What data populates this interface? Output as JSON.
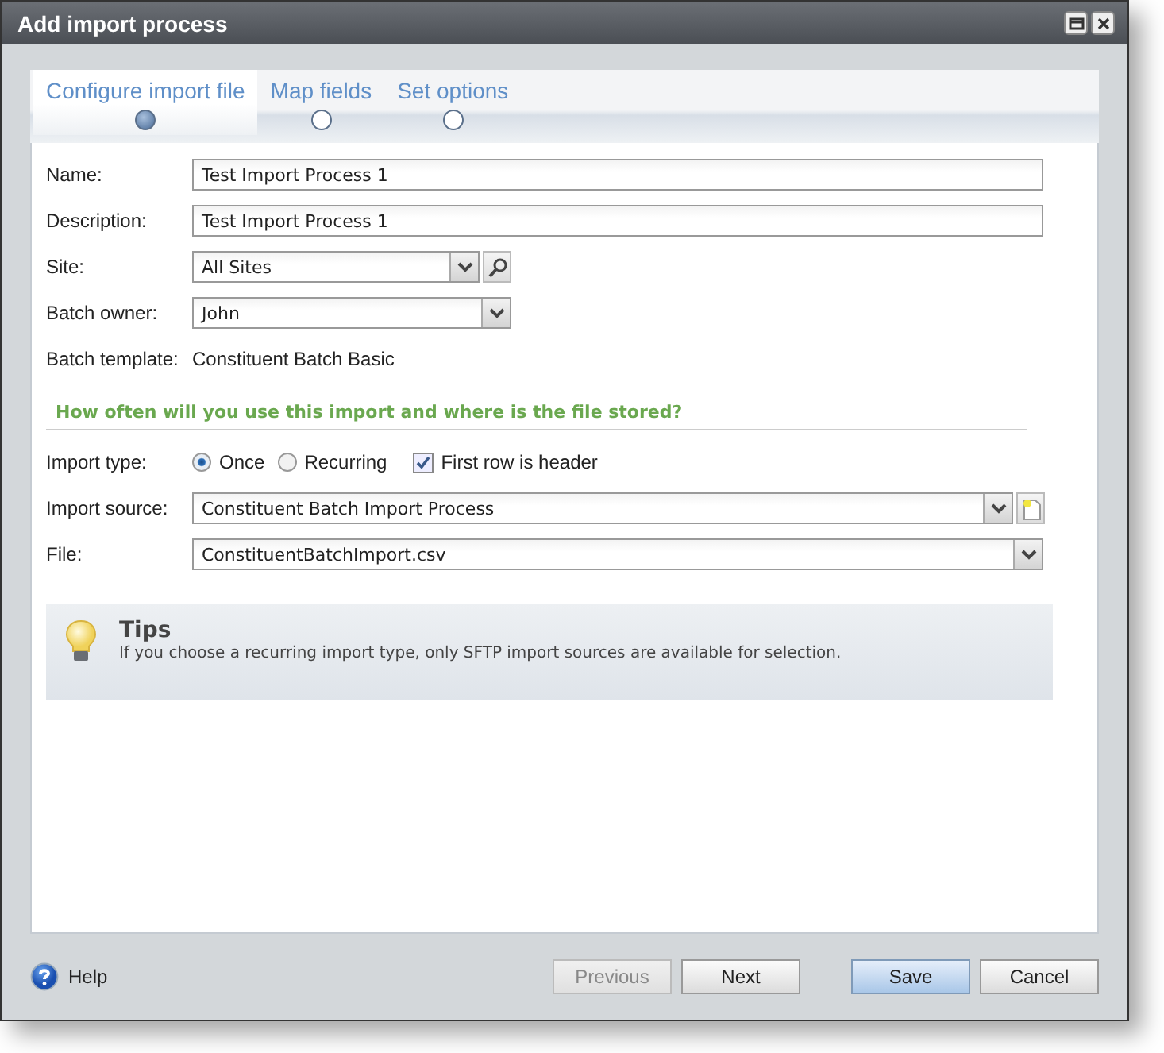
{
  "window": {
    "title": "Add import process"
  },
  "tabs": [
    {
      "label": "Configure import file",
      "selected": true
    },
    {
      "label": "Map fields",
      "selected": false
    },
    {
      "label": "Set options",
      "selected": false
    }
  ],
  "general_fields": [
    {
      "kind": "text",
      "label": "Name:",
      "value": "Test Import Process 1"
    },
    {
      "kind": "text",
      "label": "Description:",
      "value": "Test Import Process 1"
    },
    {
      "kind": "lookup",
      "label": "Site:",
      "value": "All Sites"
    },
    {
      "kind": "combo",
      "label": "Batch owner:",
      "value": "John"
    },
    {
      "kind": "static",
      "label": "Batch template:",
      "value": "Constituent Batch Basic"
    }
  ],
  "section": {
    "title": "How often will you use this import and where is the file stored?"
  },
  "import_type": {
    "label": "Import type:",
    "options": [
      {
        "label": "Once",
        "selected": true
      },
      {
        "label": "Recurring",
        "selected": false
      }
    ],
    "header_checkbox": {
      "label": "First row is header",
      "checked": true
    }
  },
  "source_fields": [
    {
      "kind": "combo_add",
      "label": "Import source:",
      "value": "Constituent Batch Import Process"
    },
    {
      "kind": "combo",
      "label": "File:",
      "value": "ConstituentBatchImport.csv"
    }
  ],
  "tips": {
    "title": "Tips",
    "text": "If you choose a recurring import type, only SFTP import sources are available for selection."
  },
  "help": {
    "label": "Help"
  },
  "buttons": [
    {
      "label": "Previous",
      "disabled": true,
      "default": false
    },
    {
      "label": "Next",
      "disabled": false,
      "default": false
    },
    {
      "label": "Save",
      "disabled": false,
      "default": true
    },
    {
      "label": "Cancel",
      "disabled": false,
      "default": false
    }
  ]
}
